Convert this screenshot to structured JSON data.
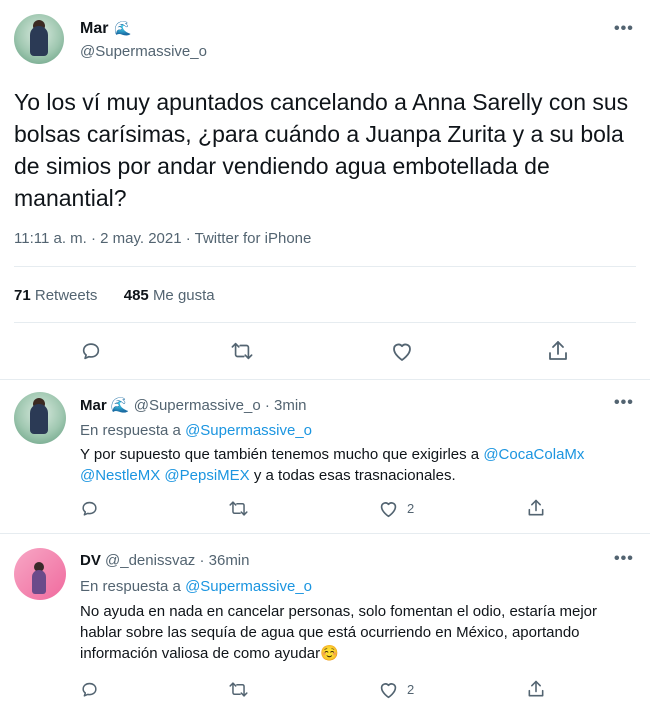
{
  "main": {
    "author_name": "Mar",
    "author_badge": "🌊",
    "author_handle": "@Supermassive_o",
    "more": "•••",
    "text": "Yo los ví muy apuntados cancelando a Anna Sarelly con sus bolsas carísimas, ¿para cuándo a Juanpa Zurita y a su bola de simios por andar vendiendo agua embotellada de manantial?",
    "timestamp": "11:11 a. m. · 2 may. 2021 · Twitter for iPhone",
    "retweets_count": "71",
    "retweets_label": "Retweets",
    "likes_count": "485",
    "likes_label": "Me gusta"
  },
  "replies": [
    {
      "author_name": "Mar",
      "author_badge": "🌊",
      "author_handle": "@Supermassive_o",
      "time": "· 3min",
      "reply_prefix": "En respuesta a",
      "reply_target": "@Supermassive_o",
      "text_1": "Y por supuesto que también tenemos mucho que exigirles a ",
      "mention_1": "@CocaColaMx",
      "mention_2": "@NestleMX",
      "mention_3": "@PepsiMEX",
      "text_2": " y a todas esas trasnacionales.",
      "like_count": "2",
      "more": "•••"
    },
    {
      "author_name": "DV",
      "author_handle": "@_denissvaz",
      "time": "· 36min",
      "reply_prefix": "En respuesta a",
      "reply_target": "@Supermassive_o",
      "text": "No ayuda en nada en cancelar personas, solo fomentan el odio, estaría mejor hablar sobre las sequía de agua que está ocurriendo en México, aportando información valiosa de como ayudar☺️",
      "like_count": "2",
      "more": "•••"
    }
  ],
  "icons": {
    "reply": "reply-icon",
    "retweet": "retweet-icon",
    "like": "heart-icon",
    "share": "share-icon"
  },
  "colors": {
    "text": "#0f1419",
    "secondary": "#536471",
    "link": "#1b95e0",
    "badge": "#1da1f2",
    "divider": "#e6ecf0"
  }
}
